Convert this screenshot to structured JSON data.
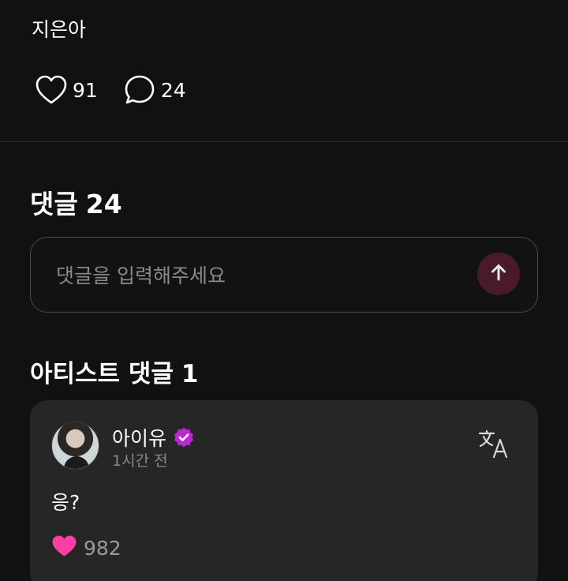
{
  "post": {
    "text": "지은아",
    "likes": "91",
    "comments": "24"
  },
  "comments_header": {
    "label": "댓글",
    "count": "24"
  },
  "comment_input": {
    "placeholder": "댓글을 입력해주세요"
  },
  "artist_section": {
    "label": "아티스트 댓글",
    "count": "1"
  },
  "artist_comment": {
    "author": "아이유",
    "time": "1시간 전",
    "text": "응?",
    "likes": "982"
  },
  "icons": {
    "like": "heart-outline-icon",
    "comment": "speech-bubble-icon",
    "send": "arrow-up-icon",
    "verified": "verified-badge-icon",
    "translate": "translate-icon",
    "liked": "heart-filled-icon"
  },
  "colors": {
    "background": "#111111",
    "card": "#262626",
    "accent_pink": "#ff3ea5",
    "verified_purple": "#c026d3",
    "send_button": "#4a1a2c"
  }
}
